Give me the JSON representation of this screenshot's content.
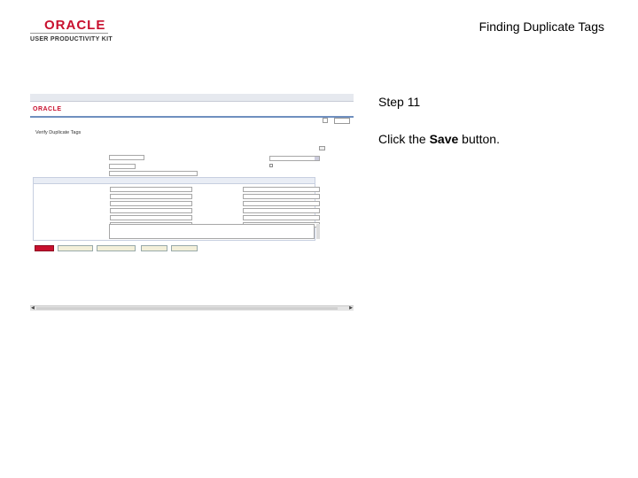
{
  "header": {
    "logo_oracle": "ORACLE",
    "logo_upk": "USER PRODUCTIVITY KIT",
    "doc_title": "Finding Duplicate Tags"
  },
  "step": {
    "label": "Step 11",
    "instruction_prefix": "Click the ",
    "instruction_bold": "Save",
    "instruction_suffix": " button."
  },
  "colors": {
    "oracle_red": "#c8102e",
    "nav_blue": "#3a5b8c"
  },
  "screenshot": {
    "brand": "ORACLE",
    "page_title": "Verify Duplicate Tags"
  }
}
